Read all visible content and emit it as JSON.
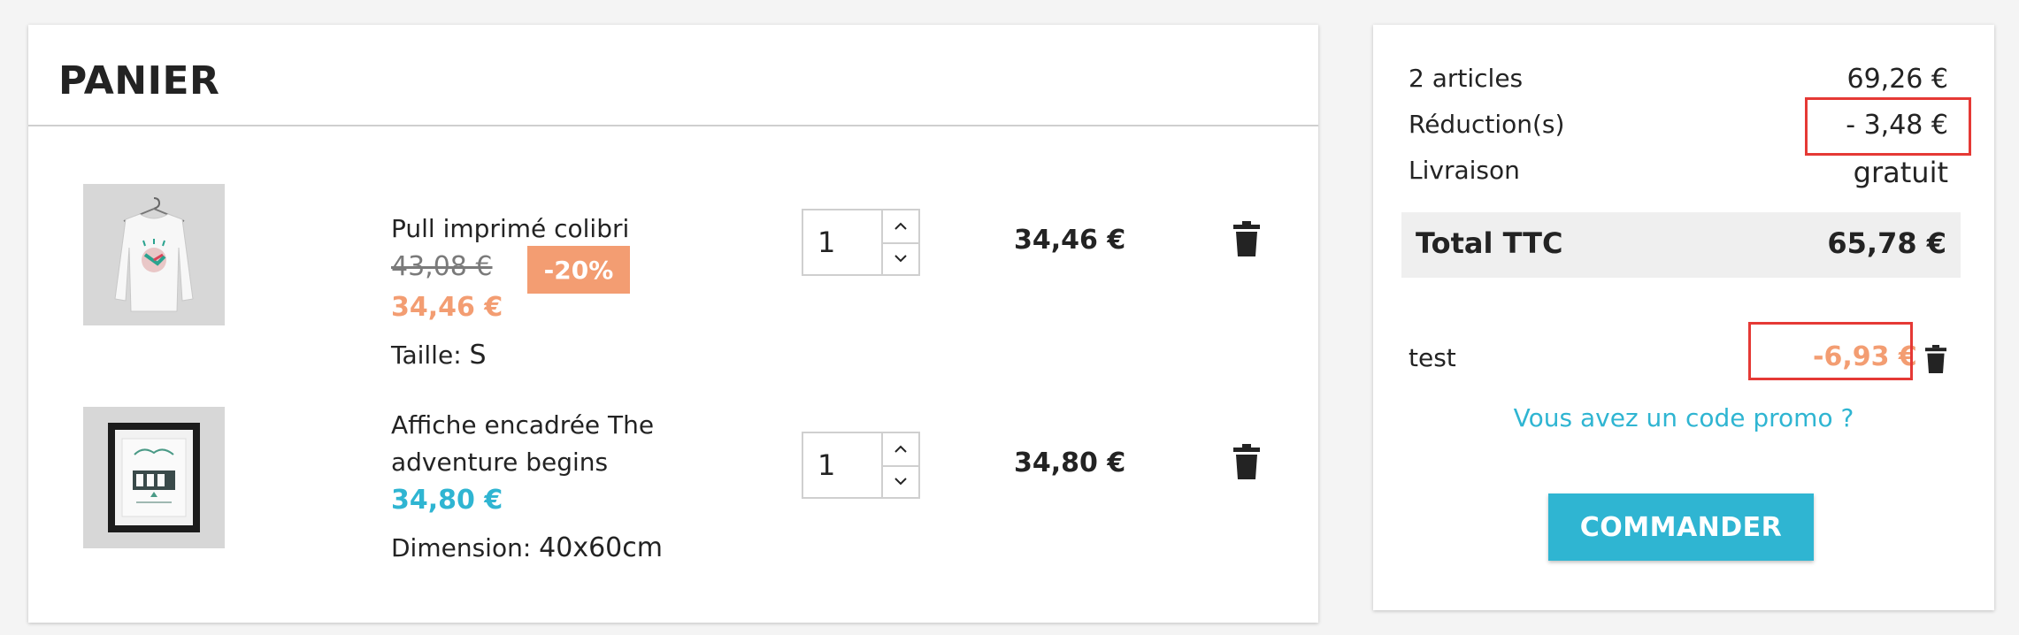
{
  "cart": {
    "title": "PANIER",
    "items": [
      {
        "name": "Pull imprimé colibri",
        "old_price": "43,08 €",
        "discount_badge": "-20%",
        "price": "34,46 €",
        "attribute_label": "Taille:",
        "attribute_value": "S",
        "quantity": "1",
        "line_total": "34,46 €",
        "image": "sweater-thumbnail"
      },
      {
        "name": "Affiche encadrée The adventure begins",
        "price": "34,80 €",
        "attribute_label": "Dimension:",
        "attribute_value": "40x60cm",
        "quantity": "1",
        "line_total": "34,80 €",
        "image": "framed-poster-thumbnail"
      }
    ]
  },
  "summary": {
    "articles_label": "2 articles",
    "articles_value": "69,26 €",
    "reduction_label": "Réduction(s)",
    "reduction_value": "- 3,48 €",
    "shipping_label": "Livraison",
    "shipping_value": "gratuit",
    "total_label": "Total TTC",
    "total_value": "65,78 €",
    "voucher_name": "test",
    "voucher_value": "-6,93 €",
    "promo_link": "Vous avez un code promo ?",
    "order_button": "COMMANDER"
  },
  "colors": {
    "accent_blue": "#2fb5d2",
    "discount_orange": "#f39d72",
    "highlight_red": "#e53935"
  },
  "icons": [
    "trash-icon",
    "chevron-up-icon",
    "chevron-down-icon"
  ]
}
